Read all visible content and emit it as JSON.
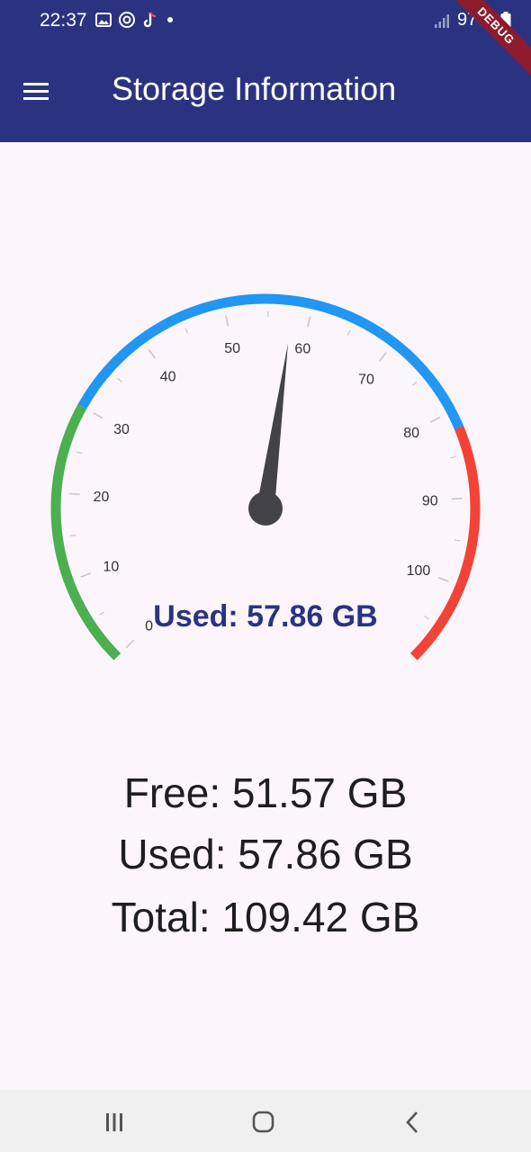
{
  "status_bar": {
    "time": "22:37",
    "battery": "97%",
    "icons": [
      "gallery-icon",
      "app-icon",
      "tiktok-icon",
      "notification-dot-icon",
      "signal-icon",
      "battery-icon"
    ]
  },
  "app_bar": {
    "title": "Storage Information",
    "menu_icon": "menu-icon",
    "debug_banner": "DEBUG",
    "background": "#2b3380"
  },
  "gauge": {
    "label": "Used: 57.86 GB",
    "value": 57.86,
    "min": 0,
    "max": 109.42,
    "tick_labels": [
      "0",
      "10",
      "20",
      "30",
      "40",
      "50",
      "60",
      "70",
      "80",
      "90",
      "100"
    ],
    "ranges": [
      {
        "from": 0,
        "to": 30,
        "color": "#4caf50"
      },
      {
        "from": 30,
        "to": 82,
        "color": "#2196f3"
      },
      {
        "from": 82,
        "to": 109.42,
        "color": "#f44336"
      }
    ],
    "needle_color": "#424248",
    "label_color": "#2b3380"
  },
  "stats": {
    "free": "Free: 51.57 GB",
    "used": "Used: 57.86 GB",
    "total": "Total: 109.42 GB"
  },
  "nav_bar": {
    "recents_icon": "recents-icon",
    "home_icon": "home-icon",
    "back_icon": "back-icon"
  }
}
